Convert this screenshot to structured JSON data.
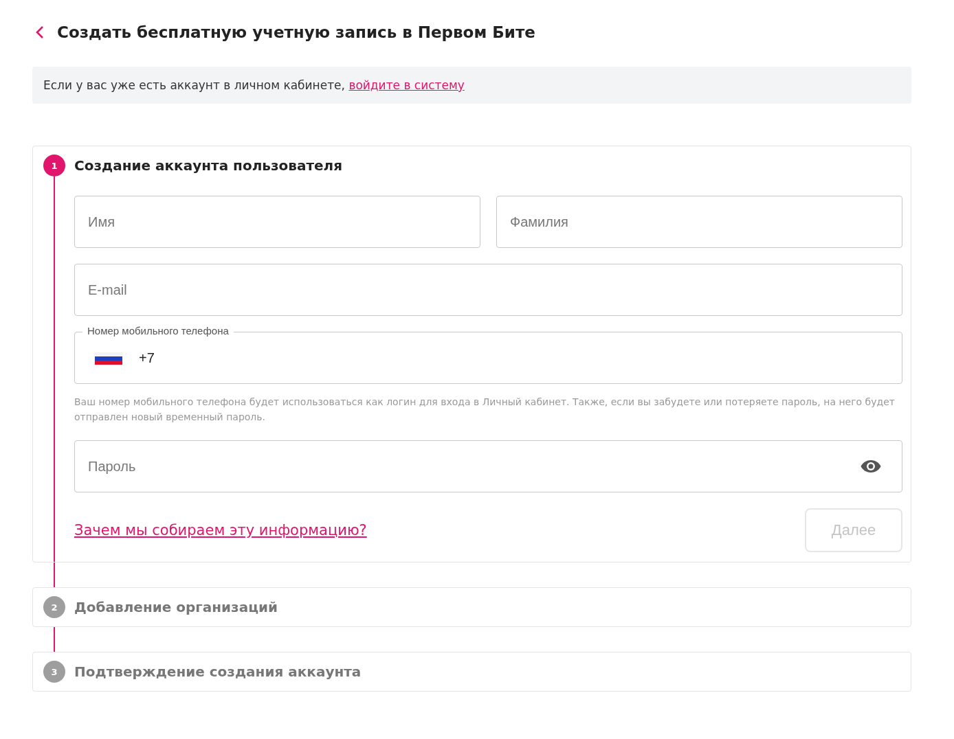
{
  "header": {
    "title": "Создать бесплатную учетную запись в Первом Бите"
  },
  "notice": {
    "text": "Если у вас уже есть аккаунт в личном кабинете, ",
    "link": "войдите в систему"
  },
  "steps": [
    {
      "number": "1",
      "title": "Создание аккаунта пользователя",
      "selected": true
    },
    {
      "number": "2",
      "title": "Добавление организаций",
      "selected": false
    },
    {
      "number": "3",
      "title": "Подтверждение создания аккаунта",
      "selected": false
    }
  ],
  "form": {
    "rows": [
      [
        {
          "kind": "text",
          "placeholder": "Имя"
        },
        {
          "kind": "text",
          "placeholder": "Фамилия"
        }
      ],
      [
        {
          "kind": "text",
          "placeholder": "E-mail"
        }
      ],
      [
        {
          "kind": "phone",
          "label": "Номер мобильного телефона",
          "value": "+7"
        }
      ],
      [
        {
          "kind": "hint",
          "text": "Ваш номер мобильного телефона будет использоваться как логин для входа в Личный кабинет. Также, если вы забудете или потеряете пароль, на него будет отправлен новый временный пароль."
        }
      ],
      [
        {
          "kind": "password",
          "placeholder": "Пароль"
        }
      ]
    ],
    "why_link": "Зачем мы собираем эту информацию?",
    "next_button": {
      "label": "Далее",
      "disabled": true
    }
  }
}
